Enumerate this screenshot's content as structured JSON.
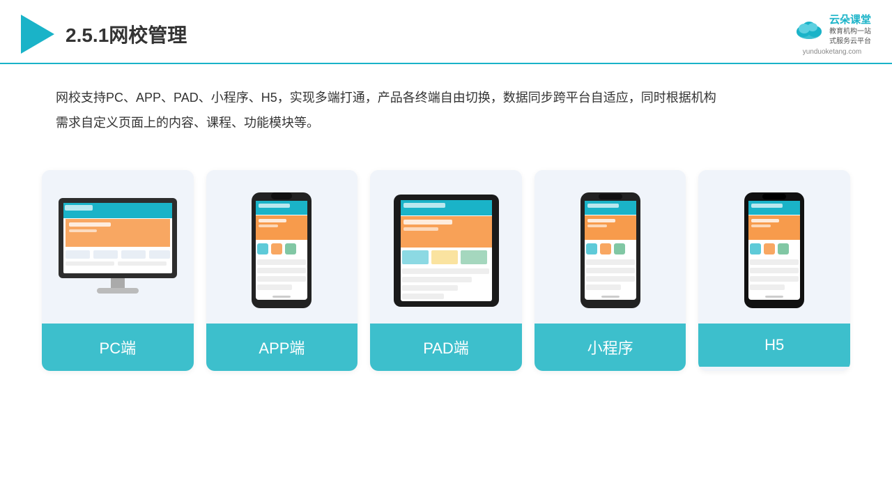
{
  "header": {
    "title": "2.5.1网校管理",
    "brand_name": "云朵课堂",
    "brand_sub": "教育机构一站\n式服务云平台",
    "brand_url": "yunduoketang.com"
  },
  "description": {
    "line1": "网校支持PC、APP、PAD、小程序、H5，实现多端打通，产品各终端自由切换，数据同步跨平台自适应，同时根据机构",
    "line2": "需求自定义页面上的内容、课程、功能模块等。"
  },
  "cards": [
    {
      "id": "pc",
      "label": "PC端",
      "type": "pc"
    },
    {
      "id": "app",
      "label": "APP端",
      "type": "phone"
    },
    {
      "id": "pad",
      "label": "PAD端",
      "type": "tablet"
    },
    {
      "id": "miniapp",
      "label": "小程序",
      "type": "phone"
    },
    {
      "id": "h5",
      "label": "H5",
      "type": "phone"
    }
  ]
}
